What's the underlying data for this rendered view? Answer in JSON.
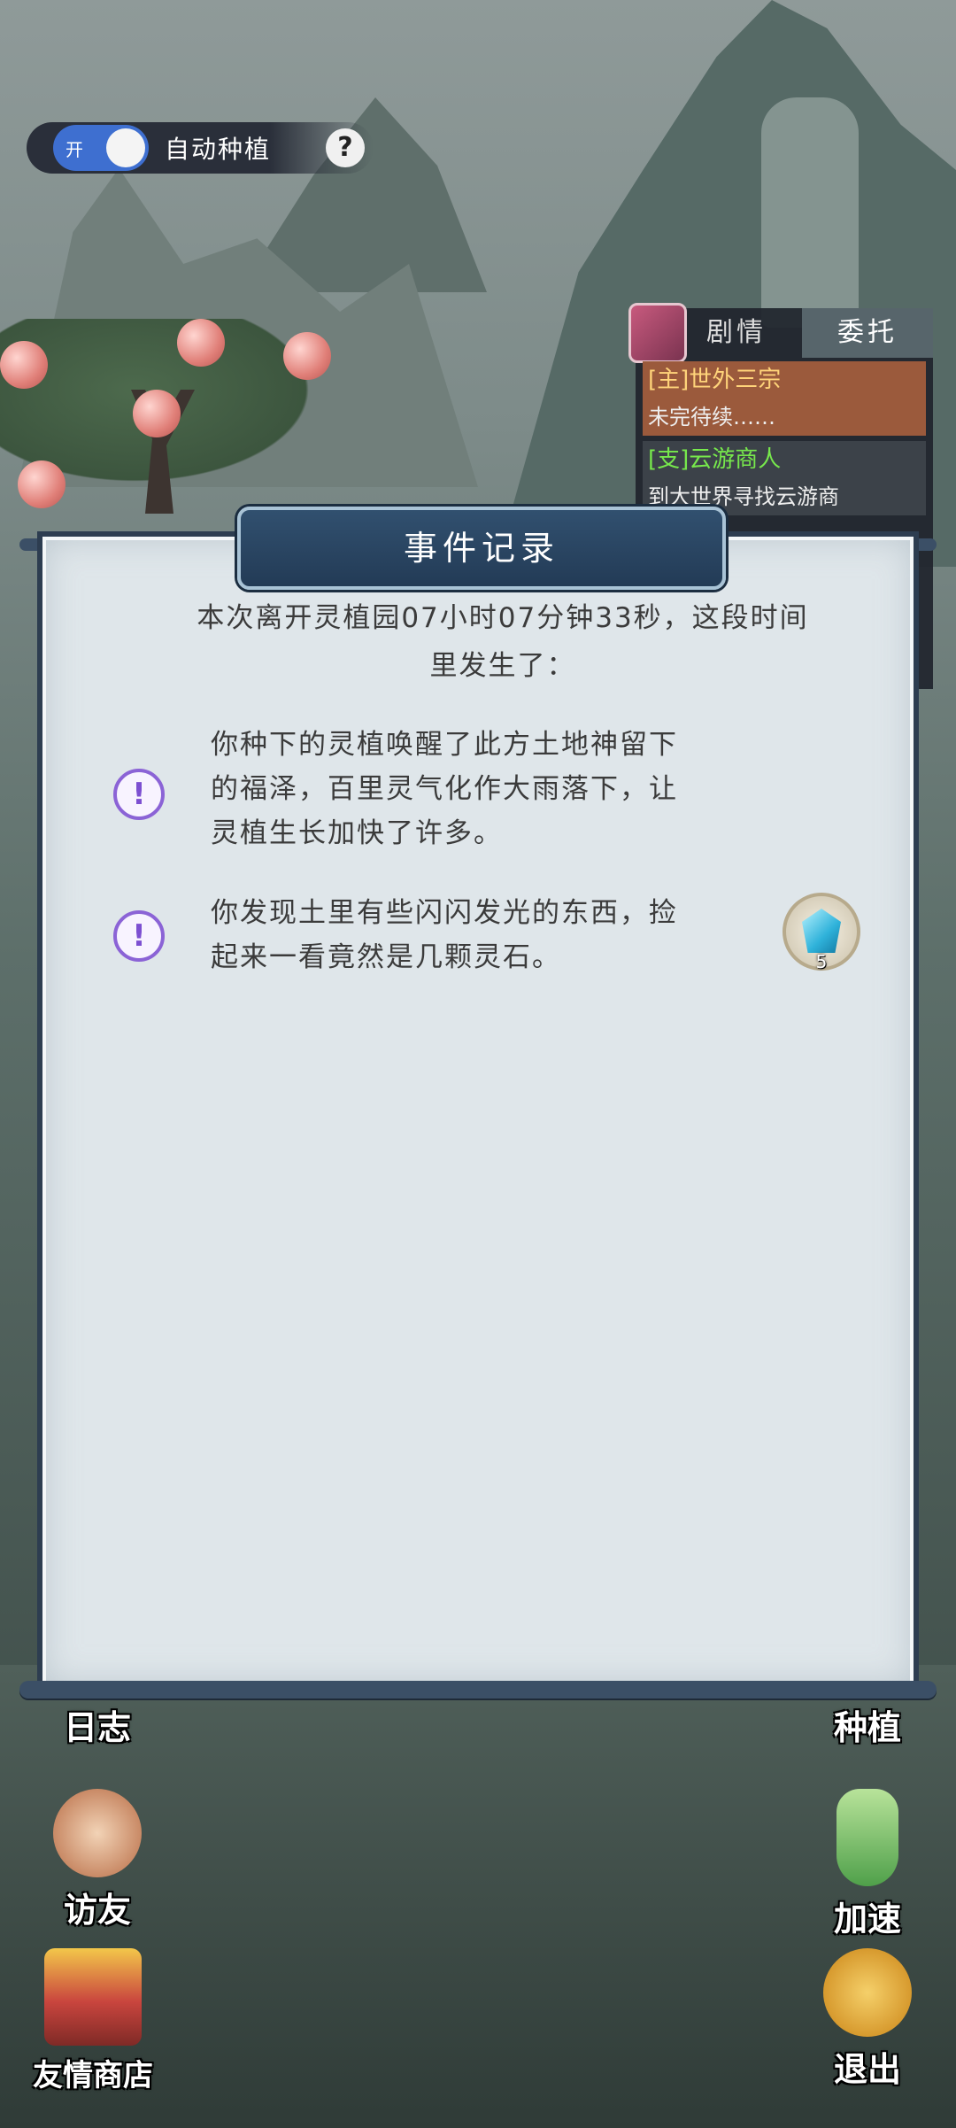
{
  "toggle": {
    "state_label": "开",
    "label": "自动种植",
    "help": "?"
  },
  "quest_panel": {
    "tabs": [
      "剧情",
      "委托"
    ],
    "items": [
      {
        "title": "[主]世外三宗",
        "desc": "未完待续……"
      },
      {
        "title": "[支]云游商人",
        "desc": "到大世界寻找云游商"
      }
    ]
  },
  "modal": {
    "title": "事件记录",
    "summary_line1": "本次离开灵植园07小时07分钟33秒，这段时间",
    "summary_line2": "里发生了：",
    "events": [
      {
        "icon": "!",
        "lines": [
          "你种下的灵植唤醒了此方土地神留下",
          "的福泽，百里灵气化作大雨落下，让",
          "灵植生长加快了许多。"
        ]
      },
      {
        "icon": "!",
        "lines": [
          "你发现土里有些闪闪发光的东西，捡",
          "起来一看竟然是几颗灵石。"
        ],
        "reward": {
          "item": "spirit-stone",
          "count": "5"
        }
      }
    ]
  },
  "buttons": {
    "log": "日志",
    "plant": "种植",
    "visit": "访友",
    "speed": "加速",
    "shop": "友情商店",
    "exit": "退出"
  },
  "colors": {
    "toggle_on": "#3e6fd0",
    "main_quest": "#ffd47a",
    "side_quest": "#77e84c",
    "modal_bg": "#dfe6ea",
    "title_banner": "#31506f",
    "event_icon": "#8b63d6"
  }
}
